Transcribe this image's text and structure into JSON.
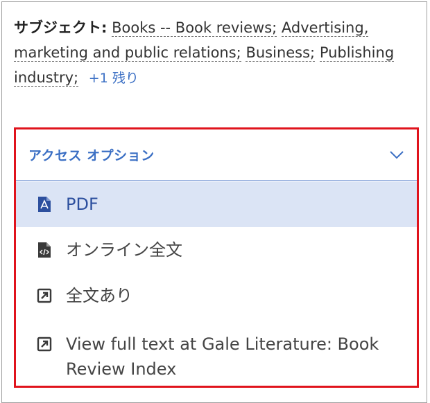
{
  "subjects": {
    "label": "サブジェクト:",
    "items": [
      "Books -- Book reviews;",
      "Advertising, marketing and public relations;",
      "Business;",
      "Publishing industry;"
    ],
    "more_link": "+1 残り"
  },
  "access": {
    "title": "アクセス オプション",
    "options": [
      {
        "label": "PDF",
        "icon": "pdf-file-icon",
        "selected": true
      },
      {
        "label": "オンライン全文",
        "icon": "code-file-icon",
        "selected": false
      },
      {
        "label": "全文あり",
        "icon": "external-link-icon",
        "selected": false
      },
      {
        "label": "View full text at Gale Literature: Book Review Index",
        "icon": "external-link-icon",
        "selected": false
      }
    ]
  },
  "colors": {
    "accent": "#3b6fc4",
    "highlight_border": "#e0131c",
    "selected_bg": "#dbe4f5"
  }
}
